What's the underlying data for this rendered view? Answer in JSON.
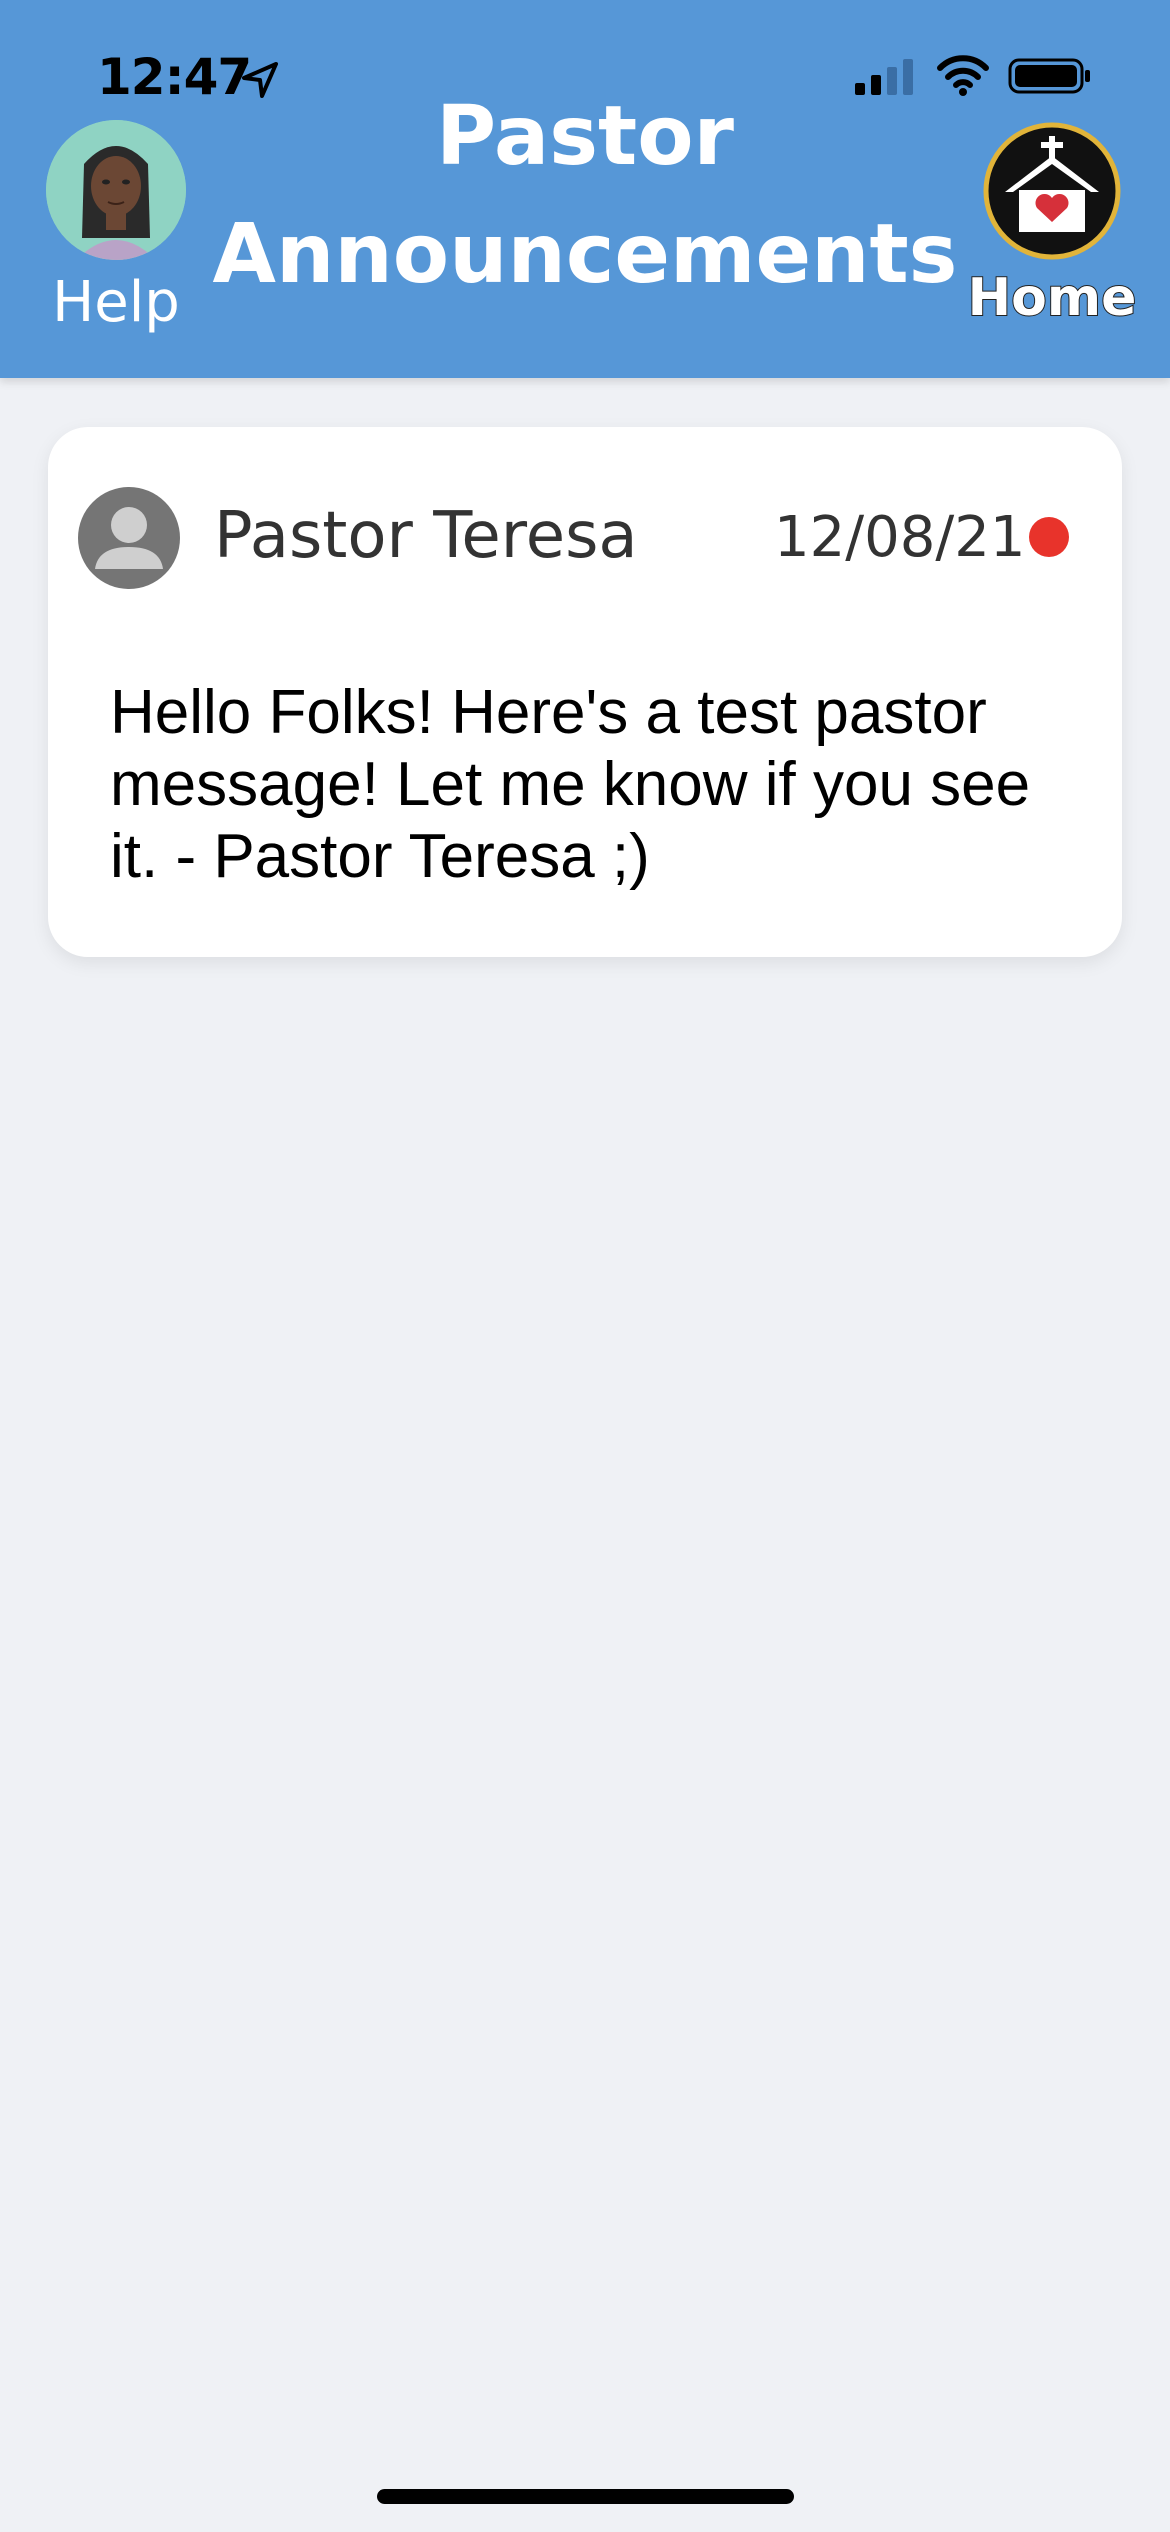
{
  "status_bar": {
    "time": "12:47",
    "icons": [
      "location-arrow-icon",
      "cellular-signal-icon",
      "wifi-icon",
      "battery-icon"
    ]
  },
  "header": {
    "title_line1": "Pastor",
    "title_line2": "Announcements",
    "help_label": "Help",
    "home_label": "Home",
    "background_color": "#5697d7"
  },
  "announcements": [
    {
      "author": "Pastor Teresa",
      "date": "12/08/21",
      "unread": true,
      "message": "Hello Folks! Here's a test pastor message! Let me know if you see it. - Pastor Teresa ;)"
    }
  ],
  "colors": {
    "page_background": "#eff1f5",
    "unread_dot": "#e8332b",
    "card_background": "#ffffff"
  }
}
